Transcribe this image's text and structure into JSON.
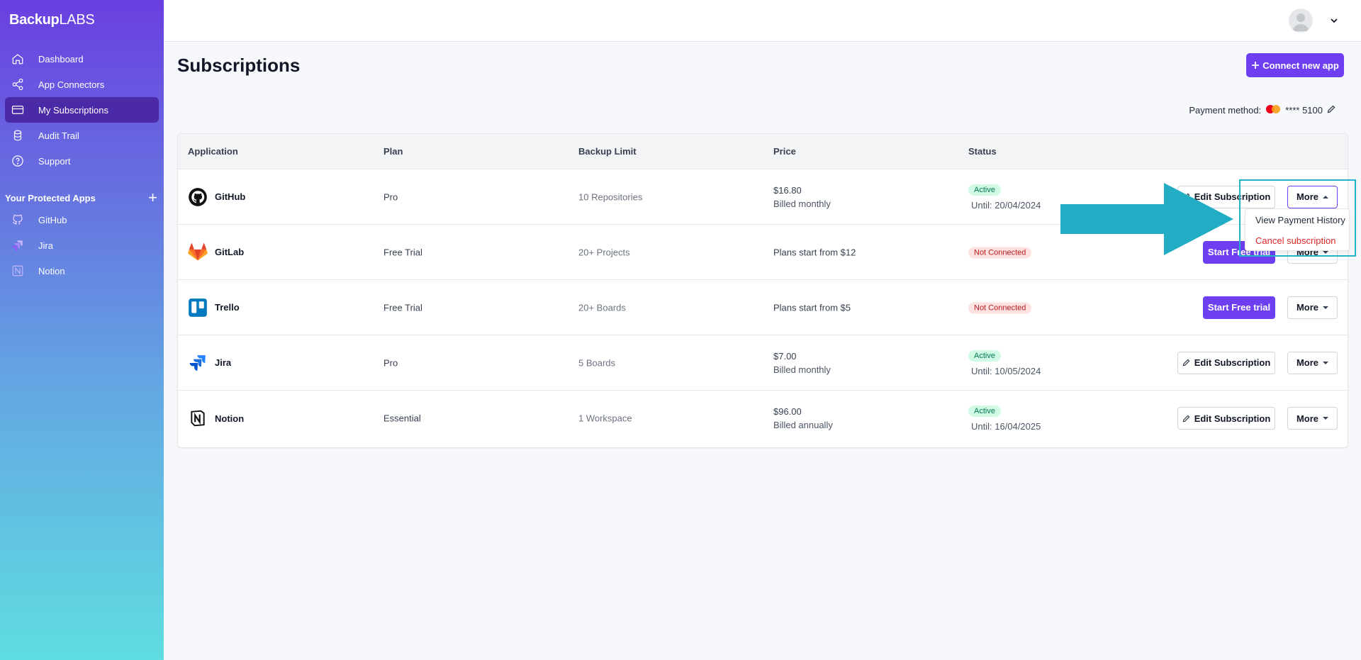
{
  "brand": {
    "name_bold": "Backup",
    "name_light": "LABS"
  },
  "sidebar": {
    "items": [
      {
        "label": "Dashboard",
        "icon": "home-icon"
      },
      {
        "label": "App Connectors",
        "icon": "share-icon"
      },
      {
        "label": "My Subscriptions",
        "icon": "credit-card-icon",
        "active": true
      },
      {
        "label": "Audit Trail",
        "icon": "database-icon"
      },
      {
        "label": "Support",
        "icon": "help-circle-icon"
      }
    ],
    "section_title": "Your Protected Apps",
    "section_add": "+",
    "protected_apps": [
      {
        "label": "GitHub",
        "icon": "github-icon"
      },
      {
        "label": "Jira",
        "icon": "jira-icon"
      },
      {
        "label": "Notion",
        "icon": "notion-icon"
      }
    ]
  },
  "header": {
    "title": "Subscriptions",
    "connect_button": "Connect new app"
  },
  "payment": {
    "label": "Payment method:",
    "card": "**** 5100"
  },
  "table": {
    "columns": [
      "Application",
      "Plan",
      "Backup Limit",
      "Price",
      "Status"
    ],
    "rows": [
      {
        "app": "GitHub",
        "plan": "Pro",
        "limit": "10 Repositories",
        "price": "$16.80",
        "billing": "Billed monthly",
        "status": "Active",
        "until": "Until: 20/04/2024",
        "action": "Edit Subscription",
        "more": "More"
      },
      {
        "app": "GitLab",
        "plan": "Free Trial",
        "limit": "20+ Projects",
        "price": "Plans start from $12",
        "billing": "",
        "status": "Not Connected",
        "until": "",
        "action": "Start Free trial",
        "more": "More"
      },
      {
        "app": "Trello",
        "plan": "Free Trial",
        "limit": "20+ Boards",
        "price": "Plans start from $5",
        "billing": "",
        "status": "Not Connected",
        "until": "",
        "action": "Start Free trial",
        "more": "More"
      },
      {
        "app": "Jira",
        "plan": "Pro",
        "limit": "5 Boards",
        "price": "$7.00",
        "billing": "Billed monthly",
        "status": "Active",
        "until": "Until: 10/05/2024",
        "action": "Edit Subscription",
        "more": "More"
      },
      {
        "app": "Notion",
        "plan": "Essential",
        "limit": "1 Workspace",
        "price": "$96.00",
        "billing": "Billed annually",
        "status": "Active",
        "until": "Until: 16/04/2025",
        "action": "Edit Subscription",
        "more": "More"
      }
    ]
  },
  "dropdown": {
    "items": [
      "View Payment History",
      "Cancel subscription"
    ]
  },
  "colors": {
    "accent": "#6d3ff0",
    "highlight": "#22b5c9",
    "active_badge": "#d1fae5",
    "danger": "#dc2626"
  }
}
